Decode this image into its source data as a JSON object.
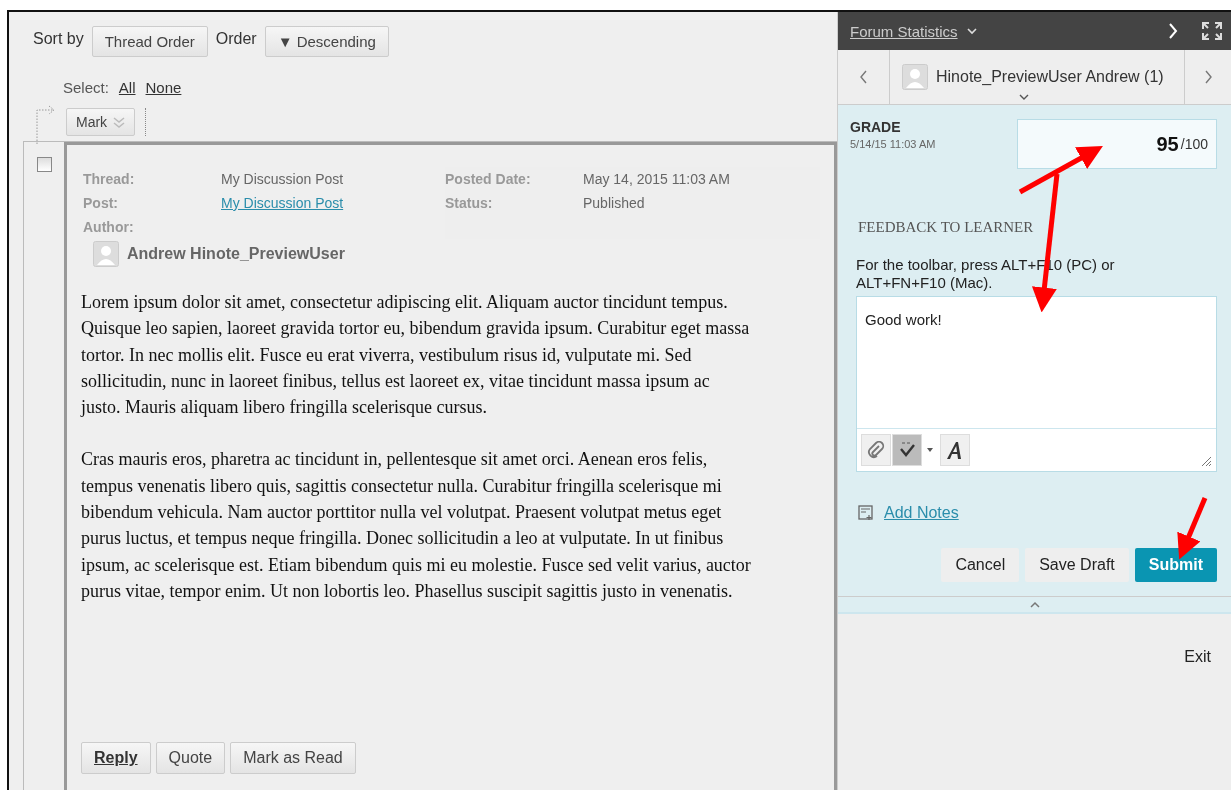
{
  "toolbar": {
    "sort_label": "Sort by",
    "sort_value": "Thread Order",
    "order_label": "Order",
    "order_value": "▼ Descending",
    "select_label": "Select:",
    "select_all": "All",
    "select_none": "None",
    "mark": "Mark"
  },
  "post": {
    "checked": false,
    "meta": [
      {
        "label": "Thread:",
        "value": "My Discussion Post",
        "kind": "text"
      },
      {
        "label": "Post:",
        "value": "My Discussion Post",
        "kind": "link"
      }
    ],
    "meta_right": [
      {
        "label": "Posted Date:",
        "value": "May 14, 2015 11:03 AM"
      },
      {
        "label": "Status:",
        "value": "Published"
      }
    ],
    "author_label": "Author:",
    "author": "Andrew Hinote_PreviewUser",
    "paragraphs": [
      "Lorem ipsum dolor sit amet, consectetur adipiscing elit. Aliquam auctor tincidunt tempus. Quisque leo sapien, laoreet gravida tortor eu, bibendum gravida ipsum. Curabitur eget massa tortor. In nec mollis elit. Fusce eu erat viverra, vestibulum risus id, vulputate mi. Sed sollicitudin, nunc in laoreet finibus, tellus est laoreet ex, vitae tincidunt massa ipsum ac justo. Mauris aliquam libero fringilla scelerisque cursus.",
      "Cras mauris eros, pharetra ac tincidunt in, pellentesque sit amet orci. Aenean eros felis, tempus venenatis libero quis, sagittis consectetur nulla. Curabitur fringilla scelerisque mi bibendum vehicula. Nam auctor porttitor nulla vel volutpat. Praesent volutpat metus eget purus luctus, et tempus neque fringilla. Donec sollicitudin a leo at vulputate. In ut finibus ipsum, ac scelerisque est. Etiam bibendum quis mi eu molestie. Fusce sed velit varius, auctor purus vitae, tempor enim. Ut non lobortis leo. Phasellus suscipit sagittis justo in venenatis."
    ],
    "actions": [
      {
        "label": "Reply",
        "primary": true
      },
      {
        "label": "Quote",
        "primary": false
      },
      {
        "label": "Mark as Read",
        "primary": false
      }
    ]
  },
  "panel": {
    "title": "Forum Statistics",
    "user": "Hinote_PreviewUser Andrew (1)",
    "grade_label": "GRADE",
    "grade_date": "5/14/15 11:03 AM",
    "grade_value": "95",
    "grade_max": "/100",
    "feedback_heading": "FEEDBACK TO LEARNER",
    "feedback_hint": "For the toolbar, press ALT+F10 (PC) or ALT+FN+F10 (Mac).",
    "feedback_text": "Good work!",
    "add_notes": "Add Notes",
    "buttons": [
      {
        "label": "Cancel",
        "kind": "plain"
      },
      {
        "label": "Save Draft",
        "kind": "plain"
      },
      {
        "label": "Submit",
        "kind": "primary"
      }
    ],
    "exit": "Exit"
  }
}
